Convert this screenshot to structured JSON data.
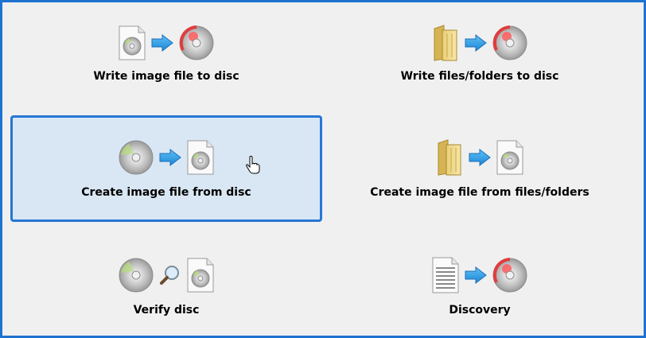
{
  "actions": [
    {
      "label": "Write image file to disc",
      "icons": [
        "disc-image-file-icon",
        "arrow-right-icon",
        "burn-disc-icon"
      ]
    },
    {
      "label": "Write files/folders to disc",
      "icons": [
        "folder-icon",
        "arrow-right-icon",
        "burn-disc-icon"
      ]
    },
    {
      "label": "Create image file from disc",
      "icons": [
        "disc-icon",
        "arrow-right-icon",
        "disc-image-file-icon"
      ]
    },
    {
      "label": "Create image file from files/folders",
      "icons": [
        "folder-icon",
        "arrow-right-icon",
        "disc-image-file-icon"
      ]
    },
    {
      "label": "Verify disc",
      "icons": [
        "disc-icon",
        "magnifier-icon",
        "disc-image-file-icon"
      ]
    },
    {
      "label": "Discovery",
      "icons": [
        "data-file-icon",
        "arrow-right-icon",
        "burn-disc-icon"
      ]
    }
  ],
  "selected_index": 2,
  "colors": {
    "background": "#f0f0f0",
    "frame": "#1e73d2",
    "selected_fill": "#d9e7f4",
    "selected_border": "#2776d4",
    "arrow": "#2d9be8"
  }
}
